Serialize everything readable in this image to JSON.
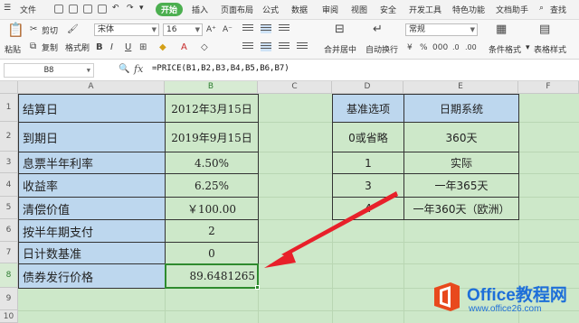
{
  "menu": {
    "file": "文件",
    "tabs": [
      "开始",
      "插入",
      "页面布局",
      "公式",
      "数据",
      "审阅",
      "视图",
      "安全",
      "开发工具",
      "特色功能",
      "文档助手"
    ],
    "search": "查找"
  },
  "ribbon": {
    "paste": "粘贴",
    "cut": "剪切",
    "copy": "复制",
    "format_painter": "格式刷",
    "font_name": "宋体",
    "font_size": "16",
    "merge_center": "合并居中",
    "wrap_text": "自动换行",
    "number_format": "常规",
    "conditional_format": "条件格式",
    "table_style": "表格样式"
  },
  "formula_bar": {
    "cell_ref": "B8",
    "fx": "fx",
    "formula": "=PRICE(B1,B2,B3,B4,B5,B6,B7)"
  },
  "columns": [
    "A",
    "B",
    "C",
    "D",
    "E",
    "F"
  ],
  "rows": [
    "1",
    "2",
    "3",
    "4",
    "5",
    "6",
    "7",
    "8",
    "9",
    "10"
  ],
  "table_left": [
    {
      "label": "结算日",
      "value": "2012年3月15日"
    },
    {
      "label": "到期日",
      "value": "2019年9月15日"
    },
    {
      "label": "息票半年利率",
      "value": "4.50%"
    },
    {
      "label": "收益率",
      "value": "6.25%"
    },
    {
      "label": "清偿价值",
      "value": "￥100.00"
    },
    {
      "label": "按半年期支付",
      "value": "2"
    },
    {
      "label": "日计数基准",
      "value": "0"
    },
    {
      "label": "债券发行价格",
      "value": "89.6481265"
    }
  ],
  "table_right": {
    "headers": [
      "基准选项",
      "日期系统"
    ],
    "rows": [
      [
        "0或省略",
        "360天"
      ],
      [
        "1",
        "实际"
      ],
      [
        "3",
        "一年365天"
      ],
      [
        "4",
        "一年360天（欧洲）"
      ]
    ]
  },
  "watermark": {
    "title": "Office教程网",
    "url": "www.office26.com"
  },
  "colors": {
    "selected_tab": "#4caf50",
    "label_fill": "#bdd7ee",
    "sheet_fill": "#cde8c9",
    "arrow": "#e8202a",
    "watermark": "#1e6fd9"
  }
}
